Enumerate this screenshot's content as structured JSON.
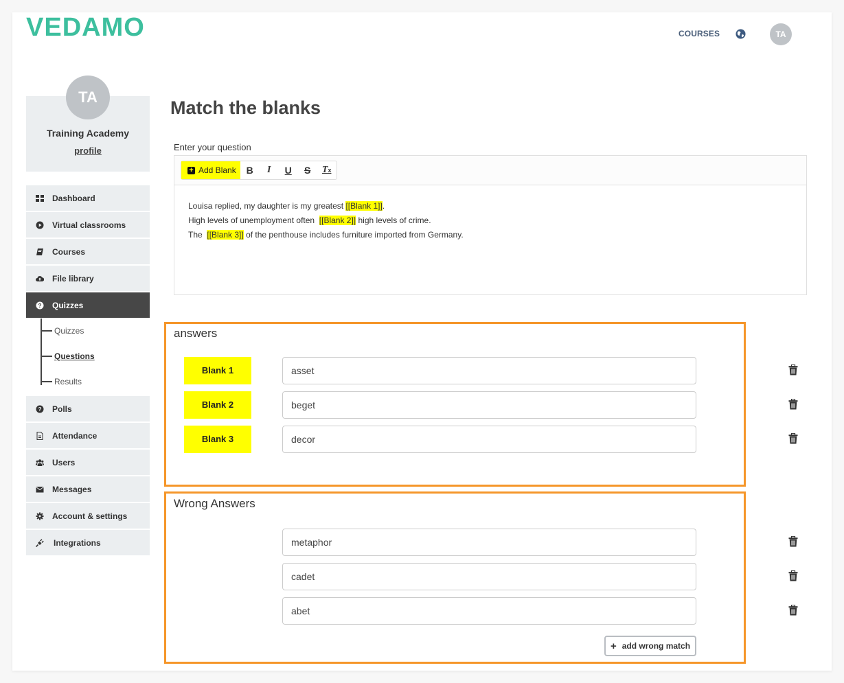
{
  "header": {
    "logo_text": "VEDAMO",
    "nav_courses": "COURSES",
    "language_icon": "globe-icon",
    "user_initials": "TA",
    "brand_color": "#3dbf9e"
  },
  "profile": {
    "initials": "TA",
    "name": "Training Academy",
    "link": "profile"
  },
  "sidebar": {
    "items": [
      {
        "label": "Dashboard",
        "icon": "dashboard-grid-icon"
      },
      {
        "label": "Virtual classrooms",
        "icon": "play-circle-icon"
      },
      {
        "label": "Courses",
        "icon": "book-icon"
      },
      {
        "label": "File library",
        "icon": "cloud-upload-icon"
      },
      {
        "label": "Quizzes",
        "icon": "question-circle-icon",
        "active": true
      },
      {
        "label": "Polls",
        "icon": "question-circle-icon"
      },
      {
        "label": "Attendance",
        "icon": "document-icon"
      },
      {
        "label": "Users",
        "icon": "users-icon"
      },
      {
        "label": "Messages",
        "icon": "envelope-icon"
      },
      {
        "label": "Account & settings",
        "icon": "gear-icon"
      },
      {
        "label": "Integrations",
        "icon": "plug-icon"
      }
    ],
    "quizzes_subitems": [
      {
        "label": "Quizzes"
      },
      {
        "label": "Questions",
        "current": true
      },
      {
        "label": "Results"
      }
    ]
  },
  "main": {
    "title": "Match the blanks",
    "question_label": "Enter your question",
    "toolbar": {
      "add_blank": "Add Blank",
      "bold": "B",
      "italic": "I",
      "underline": "U",
      "strike": "S",
      "clear_format": "T",
      "clear_format_sub": "x"
    },
    "question_lines": [
      {
        "before": "Louisa replied, my daughter is my greatest ",
        "blank": "[[Blank 1]]",
        "after": "."
      },
      {
        "before": "High levels of unemployment often  ",
        "blank": "[[Blank 2]]",
        "after": " high levels of crime."
      },
      {
        "before": "The  ",
        "blank": "[[Blank 3]]",
        "after": " of the penthouse includes furniture imported from Germany."
      }
    ],
    "answers": {
      "title": "answers",
      "rows": [
        {
          "blank": "Blank 1",
          "value": "asset"
        },
        {
          "blank": "Blank 2",
          "value": "beget"
        },
        {
          "blank": "Blank 3",
          "value": "decor"
        }
      ]
    },
    "wrong_answers": {
      "title": "Wrong Answers",
      "rows": [
        {
          "value": "metaphor"
        },
        {
          "value": "cadet"
        },
        {
          "value": "abet"
        }
      ],
      "add_button": "add wrong match"
    },
    "highlight_color": "#ffff00",
    "box_border_color": "#f5962a"
  }
}
